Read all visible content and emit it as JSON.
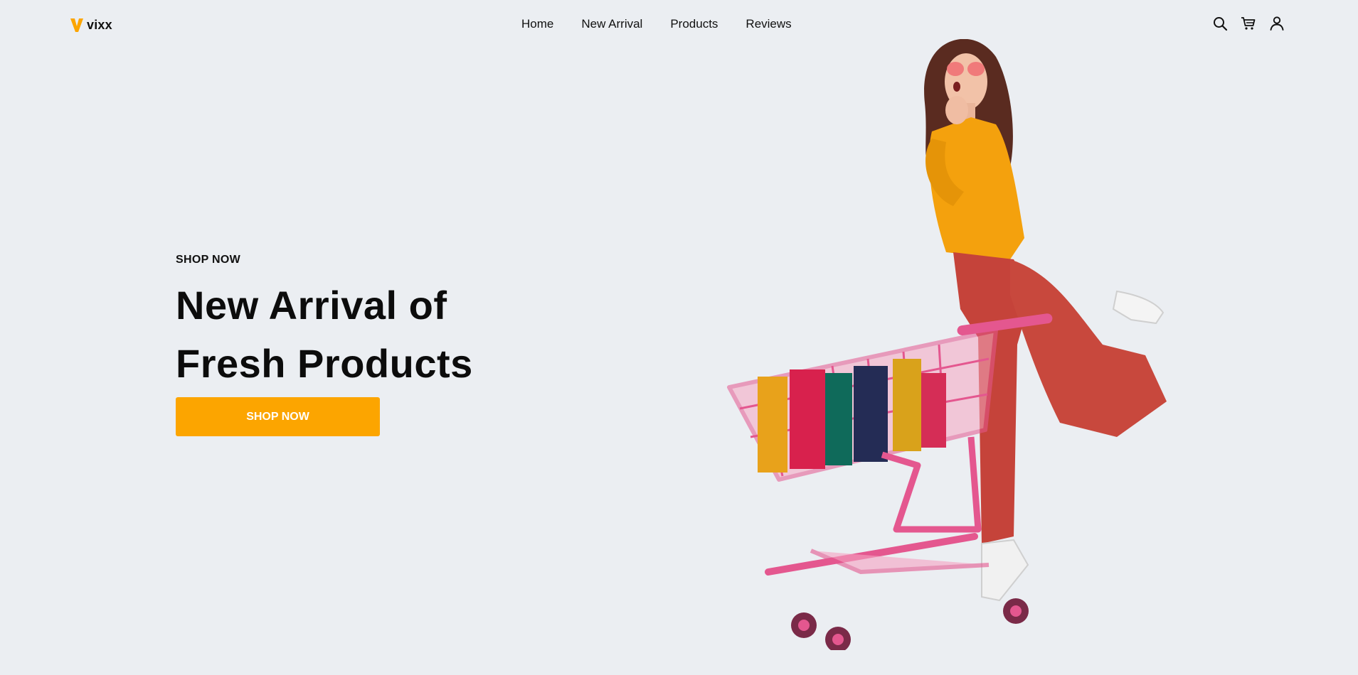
{
  "brand": {
    "name": "vixx",
    "accent": "#fca500"
  },
  "nav": {
    "links": [
      "Home",
      "New Arrival",
      "Products",
      "Reviews"
    ],
    "icons": [
      "search-icon",
      "cart-icon",
      "user-icon"
    ]
  },
  "hero": {
    "eyebrow": "SHOP NOW",
    "headline_line1": "New Arrival of",
    "headline_line2": "Fresh Products",
    "cta_label": "SHOP NOW",
    "image": "woman-with-shopping-cart"
  },
  "colors": {
    "background": "#ebeef2",
    "cta": "#fca500",
    "text": "#111111"
  }
}
